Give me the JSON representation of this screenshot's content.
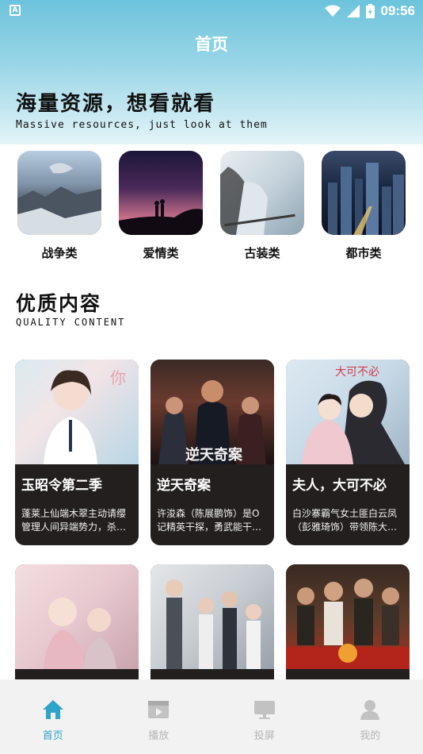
{
  "status_bar": {
    "time": "09:56"
  },
  "page": {
    "title": "首页"
  },
  "slogan": {
    "cn": "海量资源，想看就看",
    "en": "Massive resources, just look at them"
  },
  "categories": [
    {
      "label": "战争类"
    },
    {
      "label": "爱情类"
    },
    {
      "label": "古装类"
    },
    {
      "label": "都市类"
    }
  ],
  "section": {
    "cn": "优质内容",
    "en": "QUALITY CONTENT"
  },
  "cards": [
    {
      "title": "玉昭令第二季",
      "desc": "蓬莱上仙端木翠主动请缨管理人间异端势力，杀…"
    },
    {
      "title": "逆天奇案",
      "desc": "许浚森（陈展鹏饰）是O记精英干探，勇武能干…"
    },
    {
      "title": "夫人，大可不必",
      "desc": "白沙寨霸气女土匪白云凤（彭雅琦饰）带领陈大…"
    },
    {
      "title": "",
      "desc": ""
    },
    {
      "title": "",
      "desc": ""
    },
    {
      "title": "",
      "desc": ""
    }
  ],
  "tabbar": [
    {
      "label": "首页",
      "icon": "home-icon",
      "active": true
    },
    {
      "label": "播放",
      "icon": "film-icon",
      "active": false
    },
    {
      "label": "投屏",
      "icon": "monitor-icon",
      "active": false
    },
    {
      "label": "我的",
      "icon": "user-icon",
      "active": false
    }
  ],
  "colors": {
    "accent": "#2fa4c9",
    "header_top": "#6cc3dc",
    "card_bg": "#231f1f",
    "tab_inactive": "#b6b6b6"
  }
}
